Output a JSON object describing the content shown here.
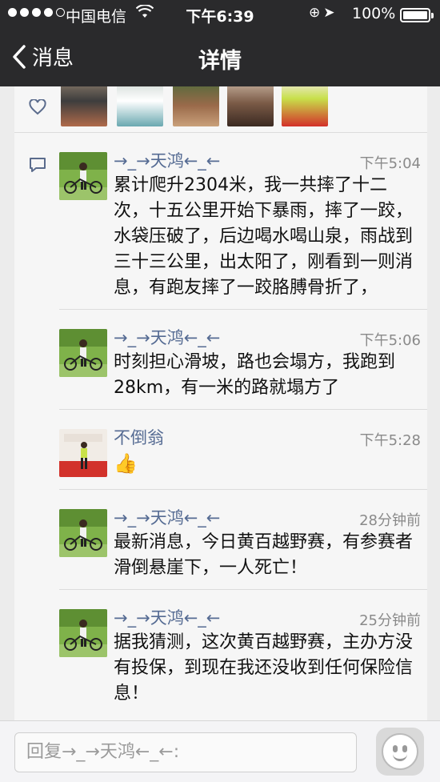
{
  "status_bar": {
    "carrier": "中国电信",
    "time": "下午6:39",
    "battery": "100%",
    "battery_level": 1.0
  },
  "nav": {
    "back_label": "消息",
    "title": "详情"
  },
  "comments": [
    {
      "name": "→_→天鸿←_←",
      "time": "下午5:04",
      "text": "累计爬升2304米，我一共摔了十二次，十五公里开始下暴雨，摔了一跤，水袋压破了，后边喝水喝山泉，雨战到三十三公里，出太阳了，刚看到一则消息，有跑友摔了一跤胳膊骨折了，",
      "avatar": "cyclist"
    },
    {
      "name": "→_→天鸿←_←",
      "time": "下午5:06",
      "text": "时刻担心滑坡，路也会塌方，我跑到28km，有一米的路就塌方了",
      "avatar": "cyclist"
    },
    {
      "name": "不倒翁",
      "time": "下午5:28",
      "text": "👍",
      "avatar": "runner-red"
    },
    {
      "name": "→_→天鸿←_←",
      "time": "28分钟前",
      "text": "最新消息，今日黄百越野赛，有参赛者滑倒悬崖下，一人死亡！",
      "avatar": "cyclist"
    },
    {
      "name": "→_→天鸿←_←",
      "time": "25分钟前",
      "text": "据我猜测，这次黄百越野赛，主办方没有投保，到现在我还没收到任何保险信息！",
      "avatar": "cyclist"
    }
  ],
  "reply": {
    "placeholder": "回复→_→天鸿←_←:"
  },
  "colors": {
    "topbar": "#2a2a2c",
    "name_link": "#556b93",
    "content_bg": "#f6f6f6"
  }
}
